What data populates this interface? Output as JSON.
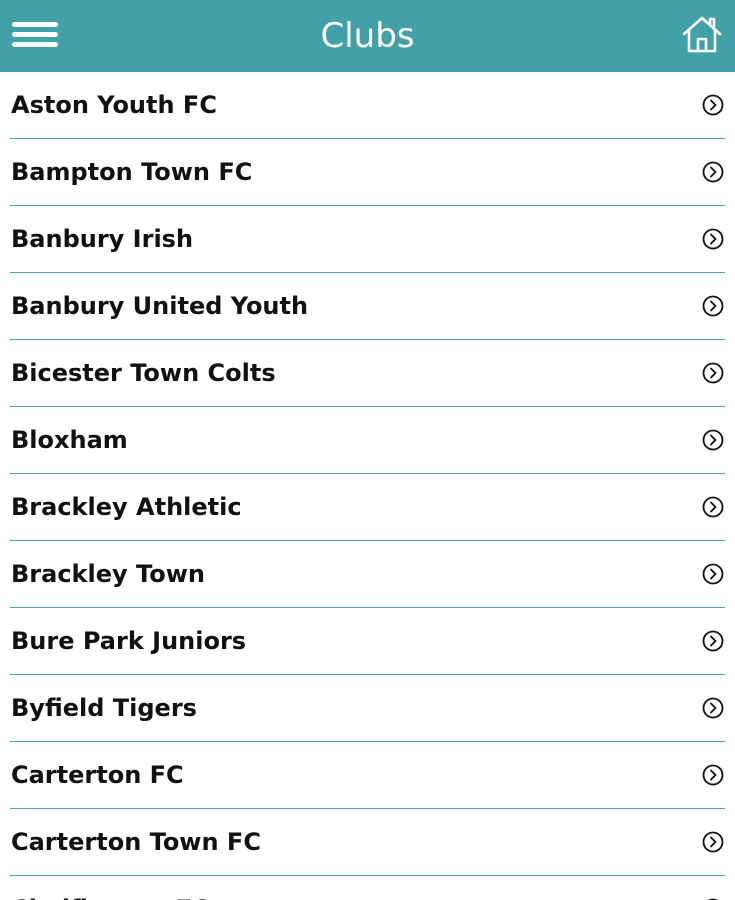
{
  "header": {
    "title": "Clubs",
    "menu_icon": "hamburger-menu-icon",
    "home_icon": "home-icon",
    "color": "#42a1a6"
  },
  "clubs": [
    {
      "label": "Aston Youth FC"
    },
    {
      "label": "Bampton Town FC"
    },
    {
      "label": "Banbury Irish"
    },
    {
      "label": "Banbury United Youth"
    },
    {
      "label": "Bicester Town Colts"
    },
    {
      "label": "Bloxham"
    },
    {
      "label": "Brackley Athletic"
    },
    {
      "label": "Brackley Town"
    },
    {
      "label": "Bure Park Juniors"
    },
    {
      "label": "Byfield Tigers"
    },
    {
      "label": "Carterton FC"
    },
    {
      "label": "Carterton Town FC"
    },
    {
      "label": "Chalfington FC"
    }
  ],
  "row_icon": "chevron-right-circle-icon",
  "divider_color": "#52a6a9"
}
